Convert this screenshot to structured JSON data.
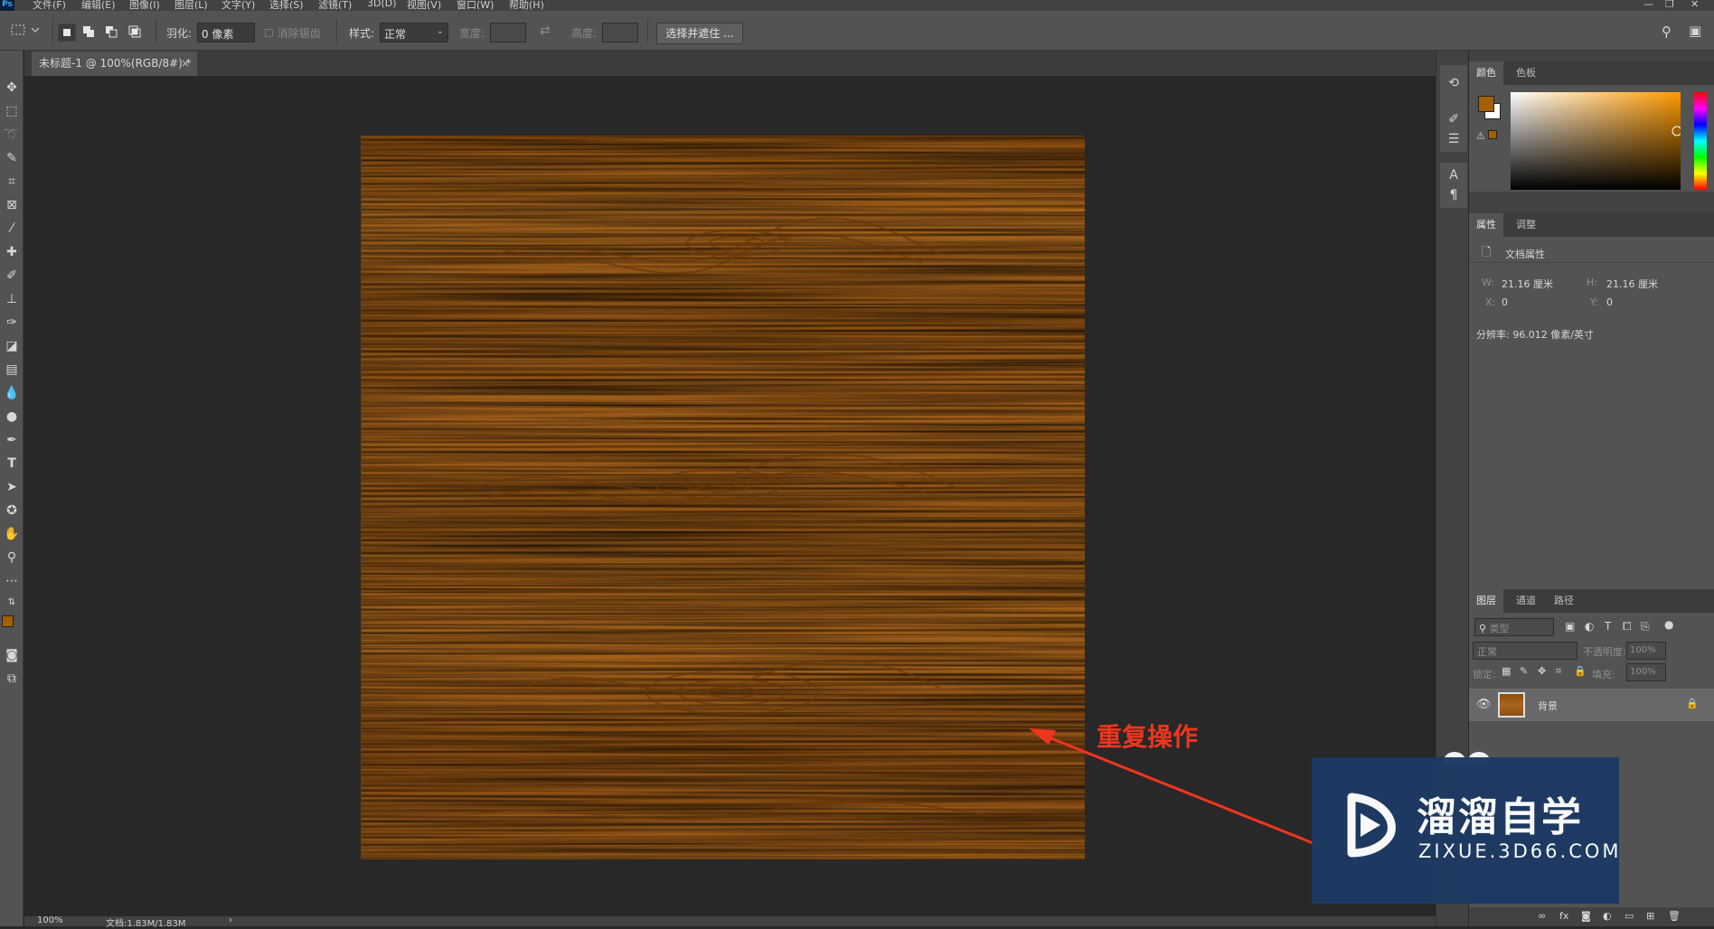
{
  "app": {
    "logo_text": "Ps"
  },
  "menu": {
    "items": [
      "文件(F)",
      "编辑(E)",
      "图像(I)",
      "图层(L)",
      "文字(Y)",
      "选择(S)",
      "滤镜(T)",
      "3D(D)",
      "视图(V)",
      "窗口(W)",
      "帮助(H)"
    ]
  },
  "options": {
    "feather_label": "羽化:",
    "feather_value": "0 像素",
    "antialias_label": "消除锯齿",
    "style_label": "样式:",
    "style_value": "正常",
    "width_label": "宽度:",
    "height_label": "高度:",
    "select_mask_button": "选择并遮住 ..."
  },
  "document": {
    "tab_title": "未标题-1 @ 100%(RGB/8#) *",
    "close_glyph": "×"
  },
  "status": {
    "zoom": "100%",
    "doc_size": "文档:1.83M/1.83M",
    "arrow": "›"
  },
  "panels": {
    "color": {
      "tabs": [
        "颜色",
        "色板"
      ],
      "fg_color": "#a45f00",
      "bg_color": "#ffffff"
    },
    "properties": {
      "tabs": [
        "属性",
        "调整"
      ],
      "section_title": "文档属性",
      "w_label": "W:",
      "w_value": "21.16 厘米",
      "h_label": "H:",
      "h_value": "21.16 厘米",
      "x_label": "X:",
      "x_value": "0",
      "y_label": "Y:",
      "y_value": "0",
      "resolution": "分辨率: 96.012 像素/英寸"
    },
    "layers": {
      "tabs": [
        "图层",
        "通道",
        "路径"
      ],
      "filter_placeholder": "类型",
      "blend_mode": "正常",
      "opacity_label": "不透明度:",
      "opacity_value": "100%",
      "lock_label": "锁定:",
      "fill_label": "填充:",
      "fill_value": "100%",
      "layer_name": "背景"
    }
  },
  "annotation": {
    "text": "重复操作",
    "color": "#f0351f"
  },
  "watermark": {
    "main": "溜溜自学",
    "sub": "ZIXUE.3D66.COM"
  }
}
